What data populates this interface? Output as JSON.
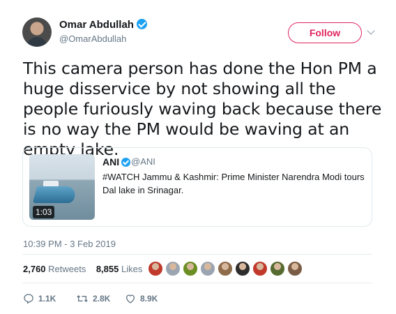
{
  "author": {
    "name": "Omar Abdullah",
    "handle": "@OmarAbdullah",
    "verified": true
  },
  "follow_label": "Follow",
  "tweet_text": "This camera person has done the Hon PM a huge disservice by not showing all the people furiously waving back because there is no way the PM would be waving at an empty lake.",
  "quoted": {
    "name": "ANI",
    "handle": "@ANI",
    "text": "#WATCH Jammu & Kashmir: Prime Minister Narendra Modi tours Dal lake in Srinagar.",
    "video_duration": "1:03"
  },
  "timestamp": "10:39 PM - 3 Feb 2019",
  "stats": {
    "retweets_count": "2,760",
    "retweets_label": "Retweets",
    "likes_count": "8,855",
    "likes_label": "Likes"
  },
  "actions": {
    "replies": "1.1K",
    "retweets": "2.8K",
    "likes": "8.9K"
  },
  "colors": {
    "accent": "#e0245e",
    "verified": "#1da1f2",
    "muted": "#657786"
  },
  "liker_avatars": [
    {
      "icon": "liker-avatar-1",
      "color": "#c0392b"
    },
    {
      "icon": "liker-avatar-2",
      "color": "#9aa5b1"
    },
    {
      "icon": "liker-avatar-3",
      "color": "#6b8e23"
    },
    {
      "icon": "liker-avatar-4",
      "color": "#9aa5b1"
    },
    {
      "icon": "liker-avatar-5",
      "color": "#8e6b4a"
    },
    {
      "icon": "liker-avatar-6",
      "color": "#2d2d2d"
    },
    {
      "icon": "liker-avatar-7",
      "color": "#c0392b"
    },
    {
      "icon": "liker-avatar-8",
      "color": "#556b2f"
    },
    {
      "icon": "liker-avatar-9",
      "color": "#7a5c44"
    }
  ]
}
